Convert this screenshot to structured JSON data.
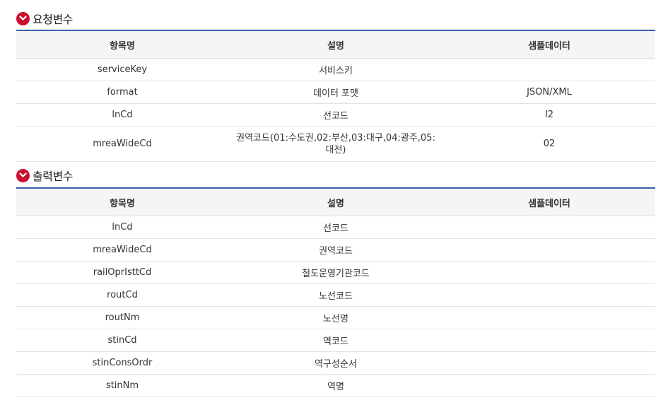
{
  "request": {
    "title": "요청변수",
    "headers": [
      "항목명",
      "설명",
      "샘플데이터"
    ],
    "rows": [
      [
        "serviceKey",
        "서비스키",
        ""
      ],
      [
        "format",
        "데이터 포맷",
        "JSON/XML"
      ],
      [
        "lnCd",
        "선코드",
        "I2"
      ],
      [
        "mreaWideCd",
        "권역코드(01:수도권,02:부산,03:대구,04:광주,05:대전)",
        "02"
      ]
    ]
  },
  "response": {
    "title": "출력변수",
    "headers": [
      "항목명",
      "설명",
      "샘플데이터"
    ],
    "rows": [
      [
        "lnCd",
        "선코드",
        ""
      ],
      [
        "mreaWideCd",
        "권역코드",
        ""
      ],
      [
        "railOprIsttCd",
        "철도운영기관코드",
        ""
      ],
      [
        "routCd",
        "노선코드",
        ""
      ],
      [
        "routNm",
        "노선명",
        ""
      ],
      [
        "stinCd",
        "역코드",
        ""
      ],
      [
        "stinConsOrdr",
        "역구성순서",
        ""
      ],
      [
        "stinNm",
        "역명",
        ""
      ]
    ]
  },
  "icons": {
    "section_toggle": "chevron-down-icon"
  },
  "colors": {
    "accent_red": "#c8102e",
    "table_border_blue": "#3a5ea8",
    "header_bg": "#f5f5f5"
  }
}
